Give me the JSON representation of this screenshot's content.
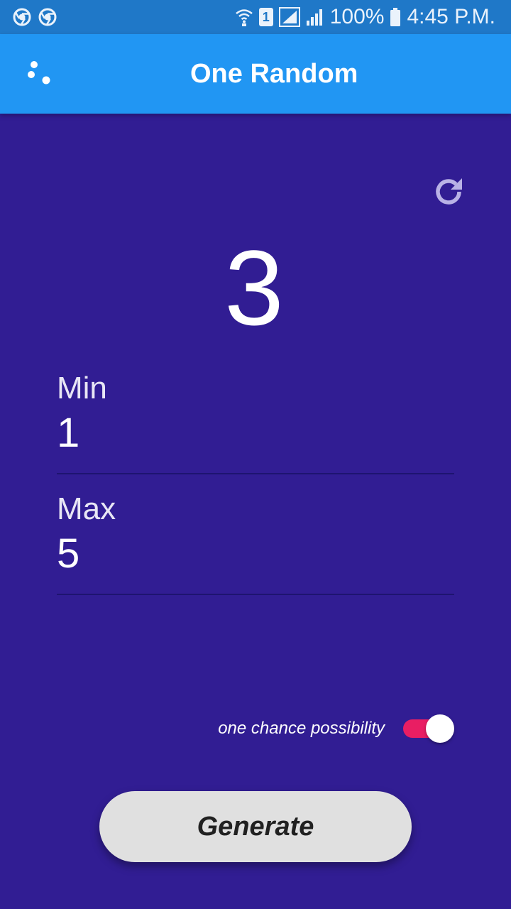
{
  "status_bar": {
    "left_icons": [
      "chrome-icon",
      "chrome-icon"
    ],
    "sim_label": "1",
    "battery": "100%",
    "time": "4:45 P.M."
  },
  "app_bar": {
    "title": "One Random",
    "logo_icon": "three-dots-logo-icon"
  },
  "result": {
    "value": "3"
  },
  "fields": {
    "min": {
      "label": "Min",
      "value": "1"
    },
    "max": {
      "label": "Max",
      "value": "5"
    }
  },
  "toggle": {
    "label": "one chance possibility",
    "state": "on",
    "accent_color": "#e91e63"
  },
  "actions": {
    "refresh_icon": "refresh-icon",
    "generate_label": "Generate"
  },
  "colors": {
    "background": "#311d93",
    "app_bar": "#2196f3",
    "status_bar": "#1f78c8",
    "button": "#e0e0e0"
  }
}
